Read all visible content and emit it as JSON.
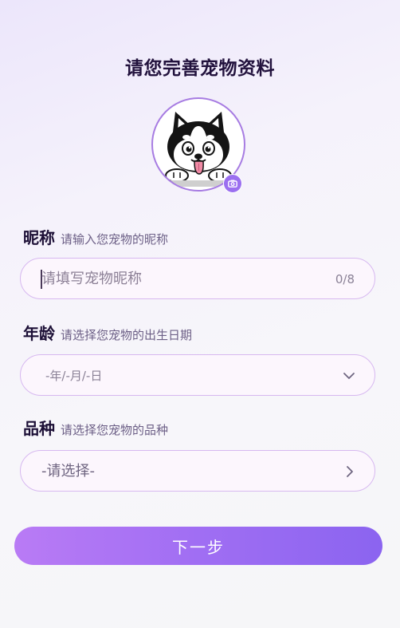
{
  "page_title": "请您完善宠物资料",
  "avatar": {
    "icon": "husky-dog-avatar",
    "badge_icon": "camera-icon",
    "ring_color": "#a77ce2",
    "badge_color": "#9b6ff0"
  },
  "nickname": {
    "label": "昵称",
    "hint": "请输入您宠物的昵称",
    "placeholder": "请填写宠物昵称",
    "value": "",
    "counter": "0/8"
  },
  "age": {
    "label": "年龄",
    "hint": "请选择您宠物的出生日期",
    "value": "-年/-月/-日",
    "icon": "chevron-down-icon"
  },
  "breed": {
    "label": "品种",
    "hint": "请选择您宠物的品种",
    "value": "-请选择-",
    "icon": "chevron-right-icon"
  },
  "next_button": {
    "label": "下一步",
    "gradient_start": "#b97bf5",
    "gradient_end": "#8b64f0"
  }
}
